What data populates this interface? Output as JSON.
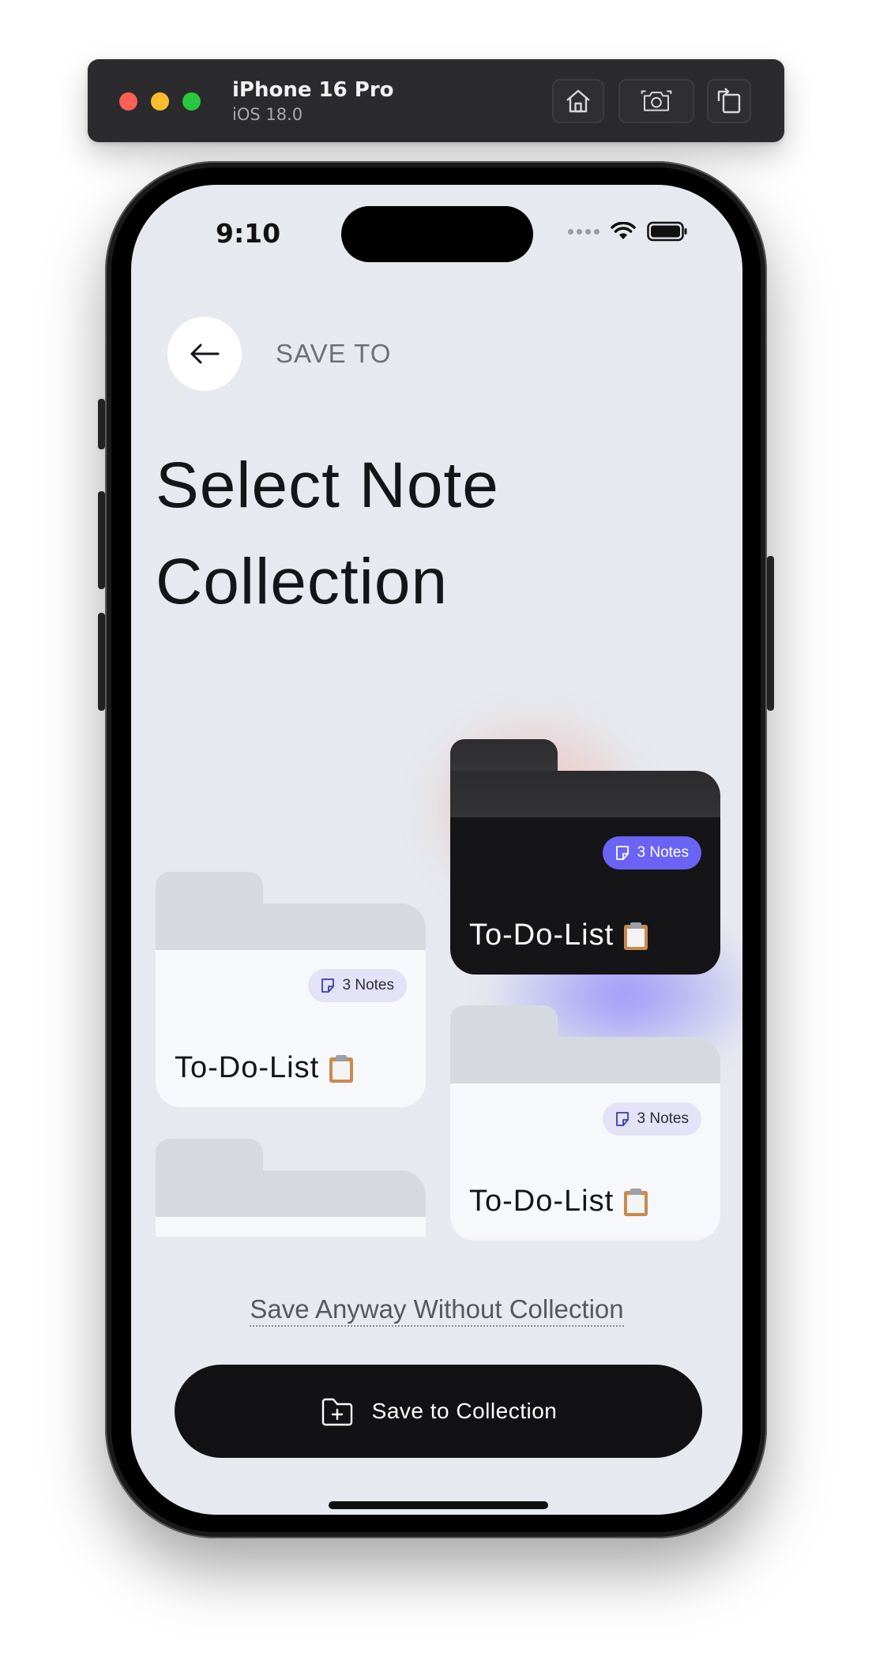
{
  "simulator": {
    "device": "iPhone 16 Pro",
    "os": "iOS 18.0",
    "icons": [
      "home-icon",
      "screenshot-icon",
      "rotate-icon"
    ]
  },
  "status_bar": {
    "time": "9:10",
    "icons": [
      "cellular-icon",
      "wifi-icon",
      "battery-icon"
    ]
  },
  "header": {
    "section_label": "SAVE TO",
    "back_icon": "arrow-left-icon"
  },
  "title": {
    "line1": "Select Note",
    "line2": "Collection"
  },
  "collections": [
    {
      "name": "To-Do-List",
      "badge": "3 Notes",
      "selected": true,
      "emoji": "clipboard"
    },
    {
      "name": "To-Do-List",
      "badge": "3 Notes",
      "selected": false,
      "emoji": "clipboard"
    },
    {
      "name": "To-Do-List",
      "badge": "3 Notes",
      "selected": false,
      "emoji": "clipboard"
    }
  ],
  "actions": {
    "secondary_link": "Save Anyway Without Collection",
    "primary_button": "Save to Collection",
    "primary_icon": "folder-plus-icon"
  },
  "colors": {
    "screen_bg": "#e6e9ef",
    "selected_card": "#151518",
    "accent_badge": "#6b63f5",
    "primary_button": "#121214"
  }
}
